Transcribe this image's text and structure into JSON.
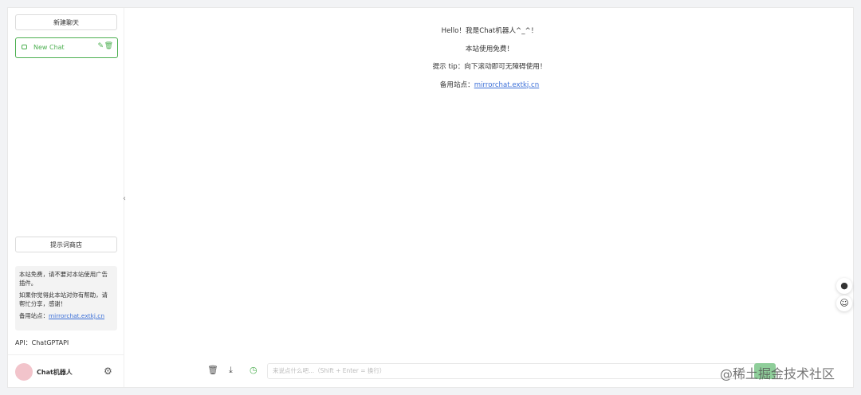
{
  "sidebar": {
    "new_chat_label": "新建聊天",
    "chats": [
      {
        "label": "New Chat"
      }
    ],
    "prompt_store_label": "提示词商店",
    "notice": {
      "line1": "本站免费，请不要对本站使用广告插件。",
      "line2": "如果你觉得此本站对你有帮助，请帮忙分享，感谢！",
      "backup_prefix": "备用站点：",
      "backup_link": "mirrorchat.extkj.cn"
    },
    "api_label": "API：ChatGPTAPI",
    "user_name": "Chat机器人"
  },
  "main": {
    "welcome": {
      "greeting": "Hello！我是Chat机器人^_^！",
      "free": "本站使用免费！",
      "tip": "提示 tip：向下滚动即可无障碍使用！",
      "backup_prefix": "备用站点：",
      "backup_link": "mirrorchat.extkj.cn"
    },
    "input_placeholder": "来说点什么吧...（Shift + Enter = 换行）"
  },
  "icons": {
    "chat": "message-square-icon",
    "edit": "edit-icon",
    "trash": "trash-icon",
    "settings": "gear-icon",
    "collapse": "chevron-left-icon",
    "download": "download-icon",
    "history": "history-icon",
    "brain": "brain-icon",
    "bot": "bot-icon"
  },
  "watermark": "@稀土掘金技术社区",
  "colors": {
    "accent": "#4caf50",
    "link": "#3b6fd8"
  }
}
